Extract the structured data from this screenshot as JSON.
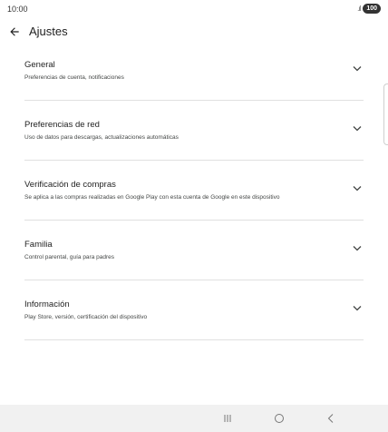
{
  "status_bar": {
    "time": "10:00",
    "battery": "100",
    "signal_icon": "signal-icon"
  },
  "app_bar": {
    "title": "Ajustes",
    "back_icon": "arrow-back-icon"
  },
  "settings": {
    "items": [
      {
        "title": "General",
        "subtitle": "Preferencias de cuenta, notificaciones"
      },
      {
        "title": "Preferencias de red",
        "subtitle": "Uso de datos para descargas, actualizaciones automáticas"
      },
      {
        "title": "Verificación de compras",
        "subtitle": "Se aplica a las compras realizadas en Google Play con esta cuenta de Google en este dispositivo"
      },
      {
        "title": "Familia",
        "subtitle": "Control parental, guía para padres"
      },
      {
        "title": "Información",
        "subtitle": "Play Store, versión, certificación del dispositivo"
      }
    ]
  },
  "nav_bar": {
    "recents_icon": "recents-icon",
    "home_icon": "home-icon",
    "back_icon": "back-nav-icon"
  },
  "colors": {
    "text_primary": "#1f1f1f",
    "text_secondary": "#444746",
    "divider": "#e0e0e0",
    "nav_bar_bg": "#f1f1f1"
  }
}
